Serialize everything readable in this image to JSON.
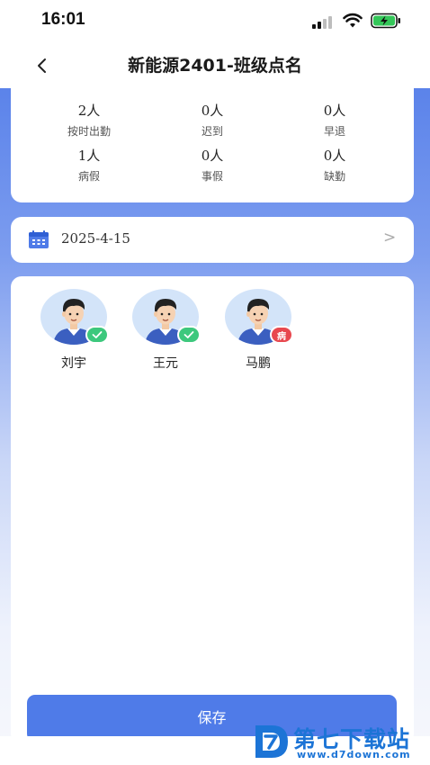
{
  "status_bar": {
    "time": "16:01"
  },
  "nav": {
    "title": "新能源2401-班级点名",
    "back_icon": "chevron-left-icon"
  },
  "stats": [
    {
      "value": "2人",
      "label": "按时出勤"
    },
    {
      "value": "0人",
      "label": "迟到"
    },
    {
      "value": "0人",
      "label": "早退"
    },
    {
      "value": "1人",
      "label": "病假"
    },
    {
      "value": "0人",
      "label": "事假"
    },
    {
      "value": "0人",
      "label": "缺勤"
    }
  ],
  "date_picker": {
    "icon": "calendar-icon",
    "value": "2025-4-15",
    "arrow": ">"
  },
  "students": [
    {
      "name": "刘宇",
      "status": "present",
      "badge_text": ""
    },
    {
      "name": "王元",
      "status": "present",
      "badge_text": ""
    },
    {
      "name": "马鹏",
      "status": "sick",
      "badge_text": "病"
    }
  ],
  "save_button": {
    "label": "保存"
  },
  "watermark": {
    "title": "第七下载站",
    "url": "www.d7down.com"
  },
  "colors": {
    "primary": "#4f7be8",
    "present_badge": "#3dc87d",
    "sick_badge": "#e8484f",
    "watermark": "#1c74d6"
  }
}
